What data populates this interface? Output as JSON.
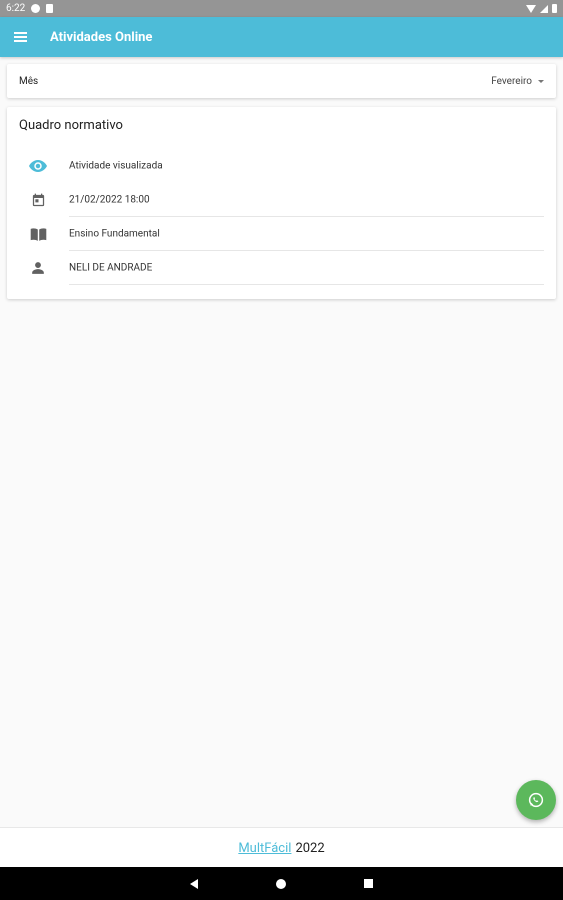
{
  "status_bar": {
    "time": "6:22"
  },
  "app_bar": {
    "title": "Atividades Online",
    "accent_color": "#4dbcd8"
  },
  "month_filter": {
    "label": "Mês",
    "selected": "Fevereiro"
  },
  "card": {
    "title": "Quadro normativo",
    "rows": [
      {
        "icon": "eye-icon",
        "text": "Atividade visualizada"
      },
      {
        "icon": "calendar-icon",
        "text": "21/02/2022 18:00"
      },
      {
        "icon": "book-icon",
        "text": "Ensino Fundamental"
      },
      {
        "icon": "person-icon",
        "text": "NELI DE ANDRADE"
      }
    ]
  },
  "footer": {
    "brand": "MultFácil",
    "year": "2022"
  },
  "fab": {
    "icon": "whatsapp-icon",
    "color": "#5cb85c"
  }
}
